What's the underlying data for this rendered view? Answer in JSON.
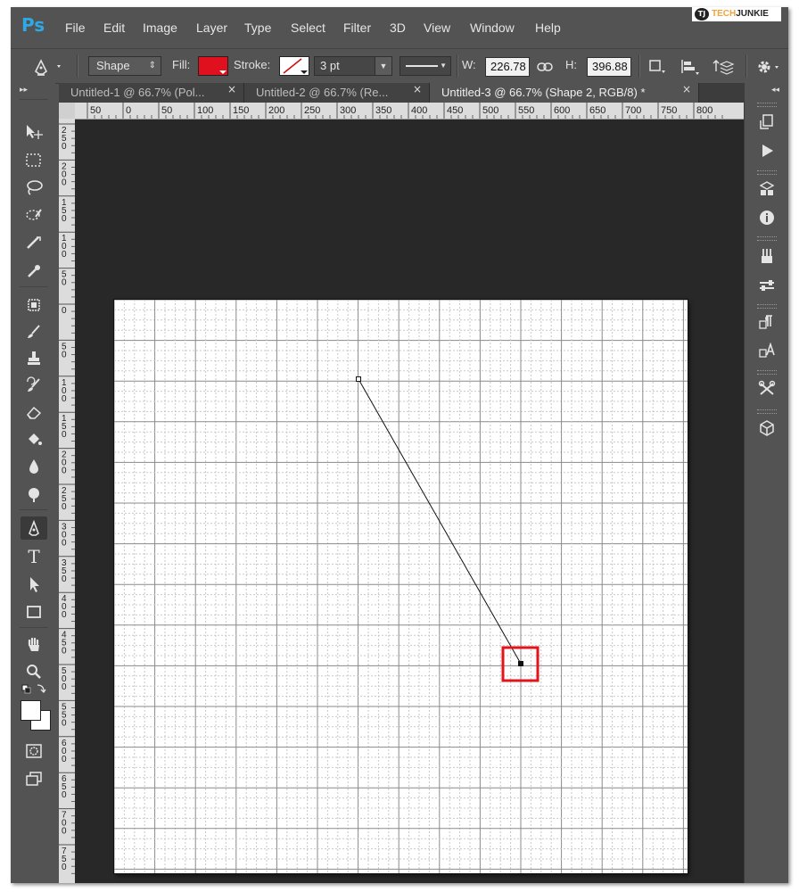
{
  "app": {
    "logo": "Ps"
  },
  "menu": [
    "File",
    "Edit",
    "Image",
    "Layer",
    "Type",
    "Select",
    "Filter",
    "3D",
    "View",
    "Window",
    "Help"
  ],
  "watermark": {
    "part1": "TECH",
    "part2": "JUNKIE",
    "logo_letters": "TJ"
  },
  "options": {
    "tool_icon": "pen-icon",
    "mode": "Shape",
    "fill_label": "Fill:",
    "fill_color": "#e0101e",
    "stroke_label": "Stroke:",
    "stroke_color": "none",
    "stroke_width": "3 pt",
    "w_label": "W:",
    "w_value": "226.78",
    "h_label": "H:",
    "h_value": "396.88"
  },
  "tabs": [
    {
      "label": "Untitled-1 @ 66.7% (Pol...",
      "close": "×",
      "active": false
    },
    {
      "label": "Untitled-2 @ 66.7% (Re...",
      "close": "×",
      "active": false
    },
    {
      "label": "Untitled-3 @ 66.7% (Shape 2, RGB/8) *",
      "close": "×",
      "active": true
    }
  ],
  "hruler_labels": [
    "50",
    "0",
    "50",
    "100",
    "150",
    "200",
    "250",
    "300",
    "350",
    "400",
    "450",
    "500",
    "550",
    "600",
    "650",
    "700",
    "750",
    "800"
  ],
  "vruler_labels": [
    "2 5 0",
    "2 0 0",
    "1 5 0",
    "1 0 0",
    "5 0",
    "0",
    "5 0",
    "1 0 0",
    "1 5 0",
    "2 0 0",
    "2 5 0",
    "3 0 0",
    "3 5 0",
    "4 0 0",
    "4 5 0",
    "5 0 0",
    "5 5 0",
    "6 0 0",
    "6 5 0",
    "7 0 0",
    "7 5 0"
  ],
  "colors": {
    "highlight": "#e3141b",
    "canvas": "#ffffff",
    "pasteboard": "#282828"
  },
  "tools": [
    "move-tool",
    "marquee-tool",
    "lasso-tool",
    "quick-select-tool",
    "crop-tool",
    "eyedropper-tool",
    "healing-tool",
    "brush-tool",
    "clone-stamp-tool",
    "history-brush-tool",
    "eraser-tool",
    "paint-bucket-tool",
    "blur-tool",
    "dodge-tool",
    "pen-tool",
    "type-tool",
    "path-select-tool",
    "rectangle-tool",
    "hand-tool",
    "zoom-tool"
  ],
  "active_tool": "pen-tool"
}
